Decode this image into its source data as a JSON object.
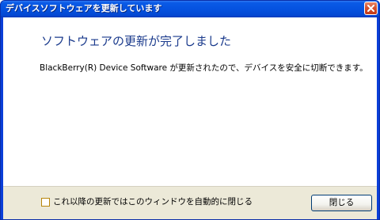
{
  "window": {
    "title": "デバイスソフトウェアを更新しています"
  },
  "content": {
    "heading": "ソフトウェアの更新が完了しました",
    "message": "BlackBerry(R) Device Software が更新されたので、デバイスを安全に切断できます。"
  },
  "footer": {
    "checkbox_label": "これ以降の更新ではこのウィンドウを自動的に閉じる",
    "checkbox_checked": false,
    "close_label": "閉じる"
  },
  "colors": {
    "titlebar": "#0552e0",
    "heading": "#1a3a8c",
    "footer_bg": "#ece9d8",
    "close_x": "#c23a16"
  },
  "icons": {
    "close": "close-icon"
  }
}
